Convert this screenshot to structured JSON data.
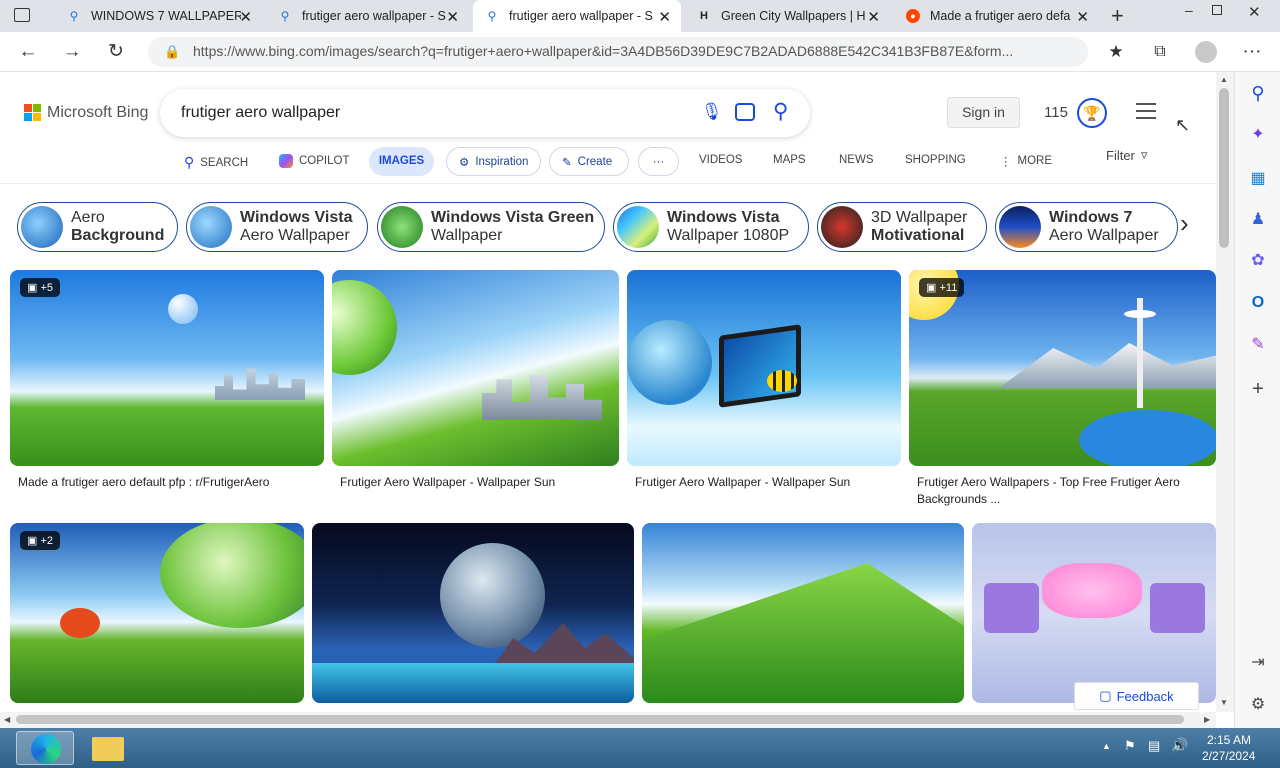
{
  "tabs": [
    {
      "title": "WINDOWS 7 WALLPAPER",
      "icon": "bing-search-icon"
    },
    {
      "title": "frutiger aero wallpaper - S",
      "icon": "bing-search-icon"
    },
    {
      "title": "frutiger aero wallpaper - S",
      "icon": "bing-search-icon"
    },
    {
      "title": "Green City Wallpapers | H",
      "icon": "h-site-icon"
    },
    {
      "title": "Made a frutiger aero defa",
      "icon": "reddit-icon"
    }
  ],
  "address": {
    "url": "https://www.bing.com/images/search?q=frutiger+aero+wallpaper&id=3A4DB56D39DE9C7B2ADAD6888E542C341B3FB87E&form..."
  },
  "header": {
    "logo": "Microsoft Bing",
    "query": "frutiger aero wallpaper",
    "signin": "Sign in",
    "points": "115"
  },
  "nav": {
    "search": "SEARCH",
    "copilot": "COPILOT",
    "images": "IMAGES",
    "inspiration": "Inspiration",
    "create": "Create",
    "more_dots": "···",
    "videos": "VIDEOS",
    "maps": "MAPS",
    "news": "NEWS",
    "shopping": "SHOPPING",
    "more": "MORE",
    "filter": "Filter"
  },
  "chips": [
    {
      "l1": "Aero",
      "l2": "Background"
    },
    {
      "l1": "Windows Vista",
      "l2": "Aero Wallpaper"
    },
    {
      "l1": "Windows Vista Green",
      "l2": "Wallpaper"
    },
    {
      "l1": "Windows Vista",
      "l2": "Wallpaper 1080P"
    },
    {
      "l1": "3D Wallpaper",
      "l2": "Motivational"
    },
    {
      "l1": "Windows 7",
      "l2": "Aero Wallpaper"
    }
  ],
  "results": [
    {
      "caption": "Made a frutiger aero default pfp : r/FrutigerAero",
      "badge": "+5"
    },
    {
      "caption": "Frutiger Aero Wallpaper - Wallpaper Sun",
      "badge": ""
    },
    {
      "caption": "Frutiger Aero Wallpaper - Wallpaper Sun",
      "badge": ""
    },
    {
      "caption": "Frutiger Aero Wallpapers - Top Free Frutiger Aero Backgrounds ...",
      "badge": "+11"
    },
    {
      "caption": "",
      "badge": "+2"
    },
    {
      "caption": "",
      "badge": ""
    },
    {
      "caption": "",
      "badge": ""
    },
    {
      "caption": "",
      "badge": ""
    }
  ],
  "feedback": "Feedback",
  "taskbar": {
    "time": "2:15 AM",
    "date": "2/27/2024"
  },
  "colors": {
    "accent": "#174ae4",
    "chip_border": "#1b4b9a",
    "taskbar": "#3a6a92"
  }
}
